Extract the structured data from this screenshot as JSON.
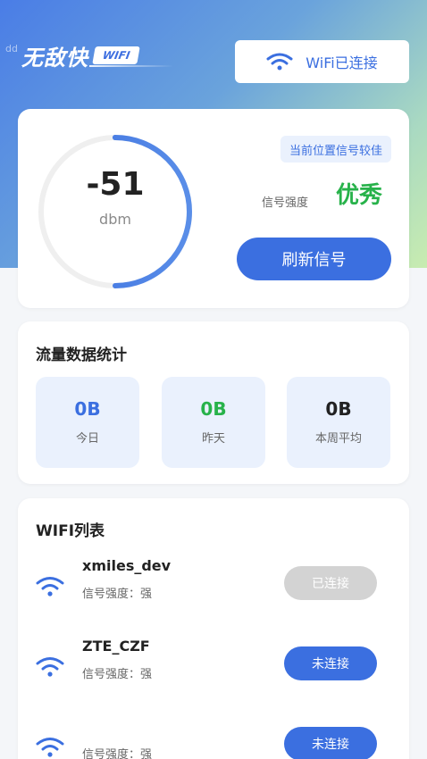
{
  "header": {
    "faint_text": "dd",
    "brand_name": "无敌快",
    "brand_badge": "WIFI",
    "wifi_status": "WiFi已连接"
  },
  "signal": {
    "value": "-51",
    "unit": "dbm",
    "gauge_fill_fraction": 0.5,
    "hint": "当前位置信号较佳",
    "strength_label": "信号强度",
    "strength_value": "优秀",
    "refresh_label": "刷新信号"
  },
  "traffic": {
    "title": "流量数据统计",
    "stats": [
      {
        "value": "0B",
        "label": "今日",
        "color": "#3b6fe0"
      },
      {
        "value": "0B",
        "label": "昨天",
        "color": "#27b24a"
      },
      {
        "value": "0B",
        "label": "本周平均",
        "color": "#222222"
      }
    ]
  },
  "wifi_list": {
    "title": "WIFI列表",
    "items": [
      {
        "ssid": "xmiles_dev",
        "strength": "信号强度：强",
        "status": "已连接"
      },
      {
        "ssid": "ZTE_CZF",
        "strength": "信号强度：强",
        "status": "未连接"
      },
      {
        "ssid": "",
        "strength": "信号强度：强",
        "status": "未连接"
      }
    ]
  },
  "colors": {
    "accent": "#3b6fe0",
    "success": "#27b24a",
    "disabled": "#d3d3d3"
  }
}
